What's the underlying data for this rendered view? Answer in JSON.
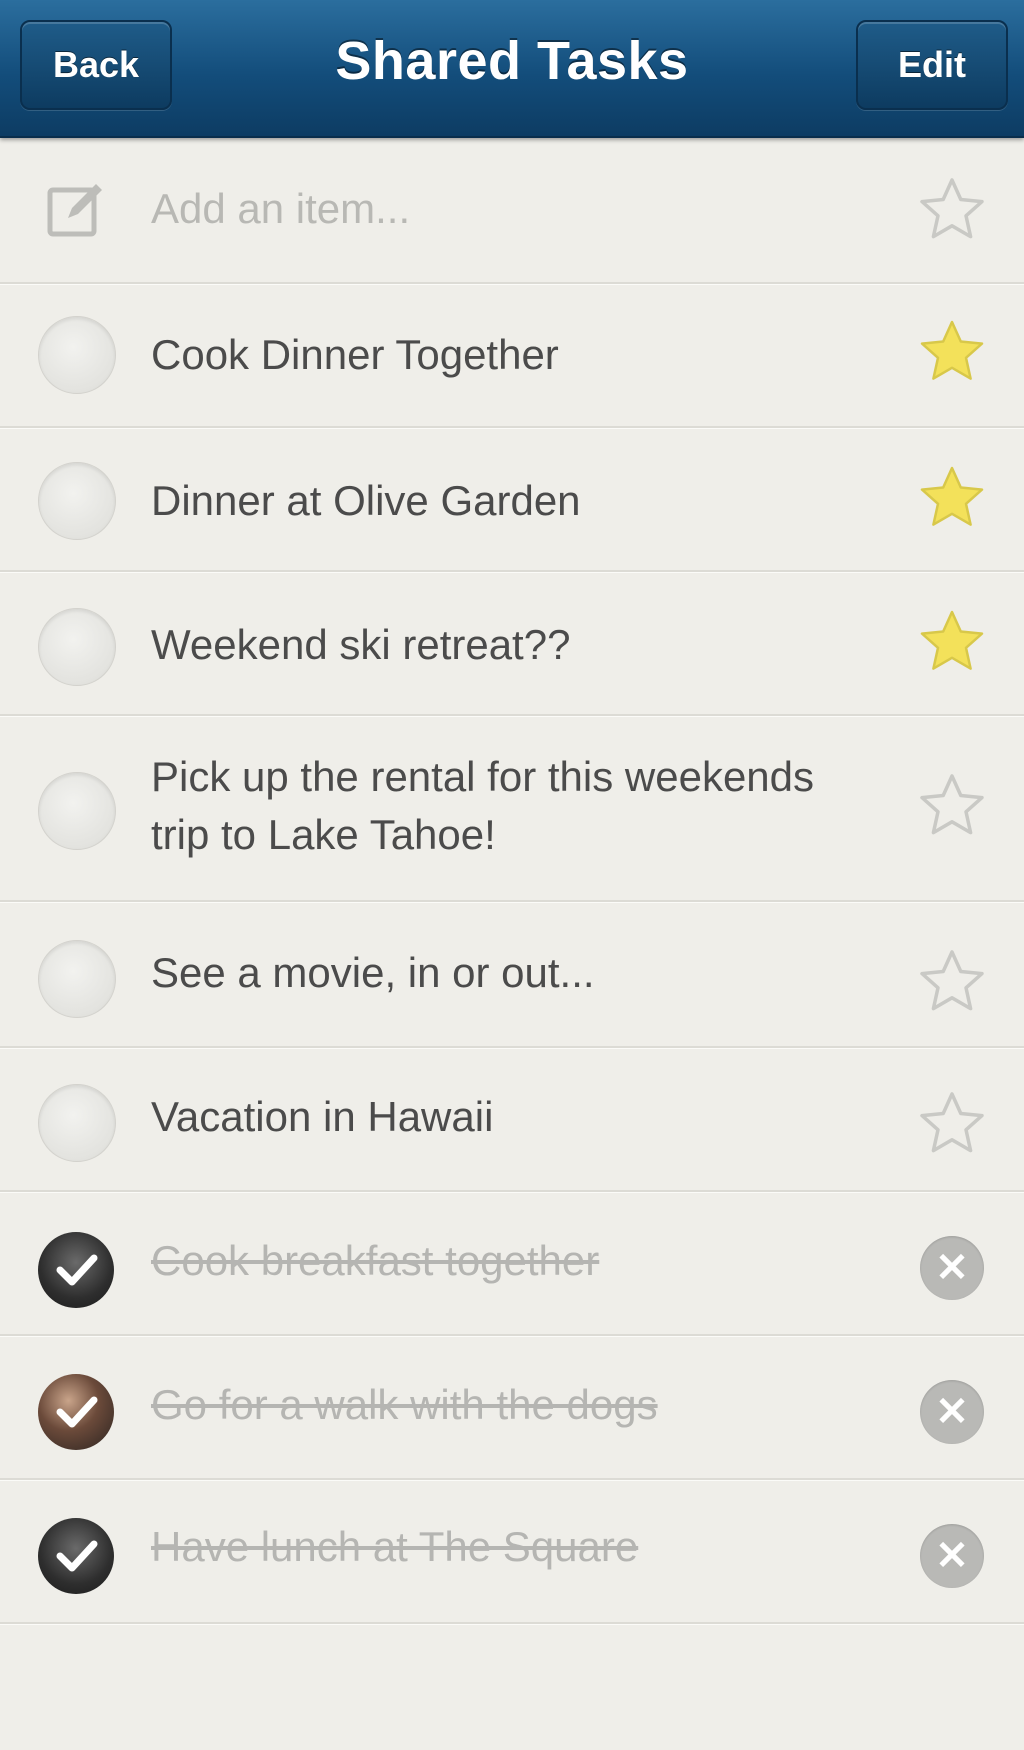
{
  "navbar": {
    "title": "Shared Tasks",
    "back_label": "Back",
    "edit_label": "Edit"
  },
  "add_item": {
    "placeholder": "Add an item...",
    "icon": "edit-icon",
    "star": "star-outline-icon"
  },
  "tasks": [
    {
      "text": "Cook Dinner Together",
      "starred": true,
      "completed": false
    },
    {
      "text": "Dinner at Olive Garden",
      "starred": true,
      "completed": false
    },
    {
      "text": "Weekend ski retreat??",
      "starred": true,
      "completed": false
    },
    {
      "text_line1": "Pick up the rental for this weekends",
      "text_line2": "trip to Lake Tahoe!",
      "starred": false,
      "completed": false
    },
    {
      "text": "See a movie, in or out...",
      "starred": false,
      "completed": false
    },
    {
      "text": "Vacation in Hawaii",
      "starred": false,
      "completed": false
    }
  ],
  "completed_tasks": [
    {
      "text": "Cook breakfast together",
      "completed": true
    },
    {
      "text": "Go for a walk with the dogs",
      "completed": true
    },
    {
      "text": "Have lunch at The Square",
      "completed": true
    }
  ],
  "colors": {
    "navbar": "#134d7b",
    "star_filled": "#f3e15a",
    "star_outline": "#c9c9c5",
    "background": "#efeee9"
  }
}
